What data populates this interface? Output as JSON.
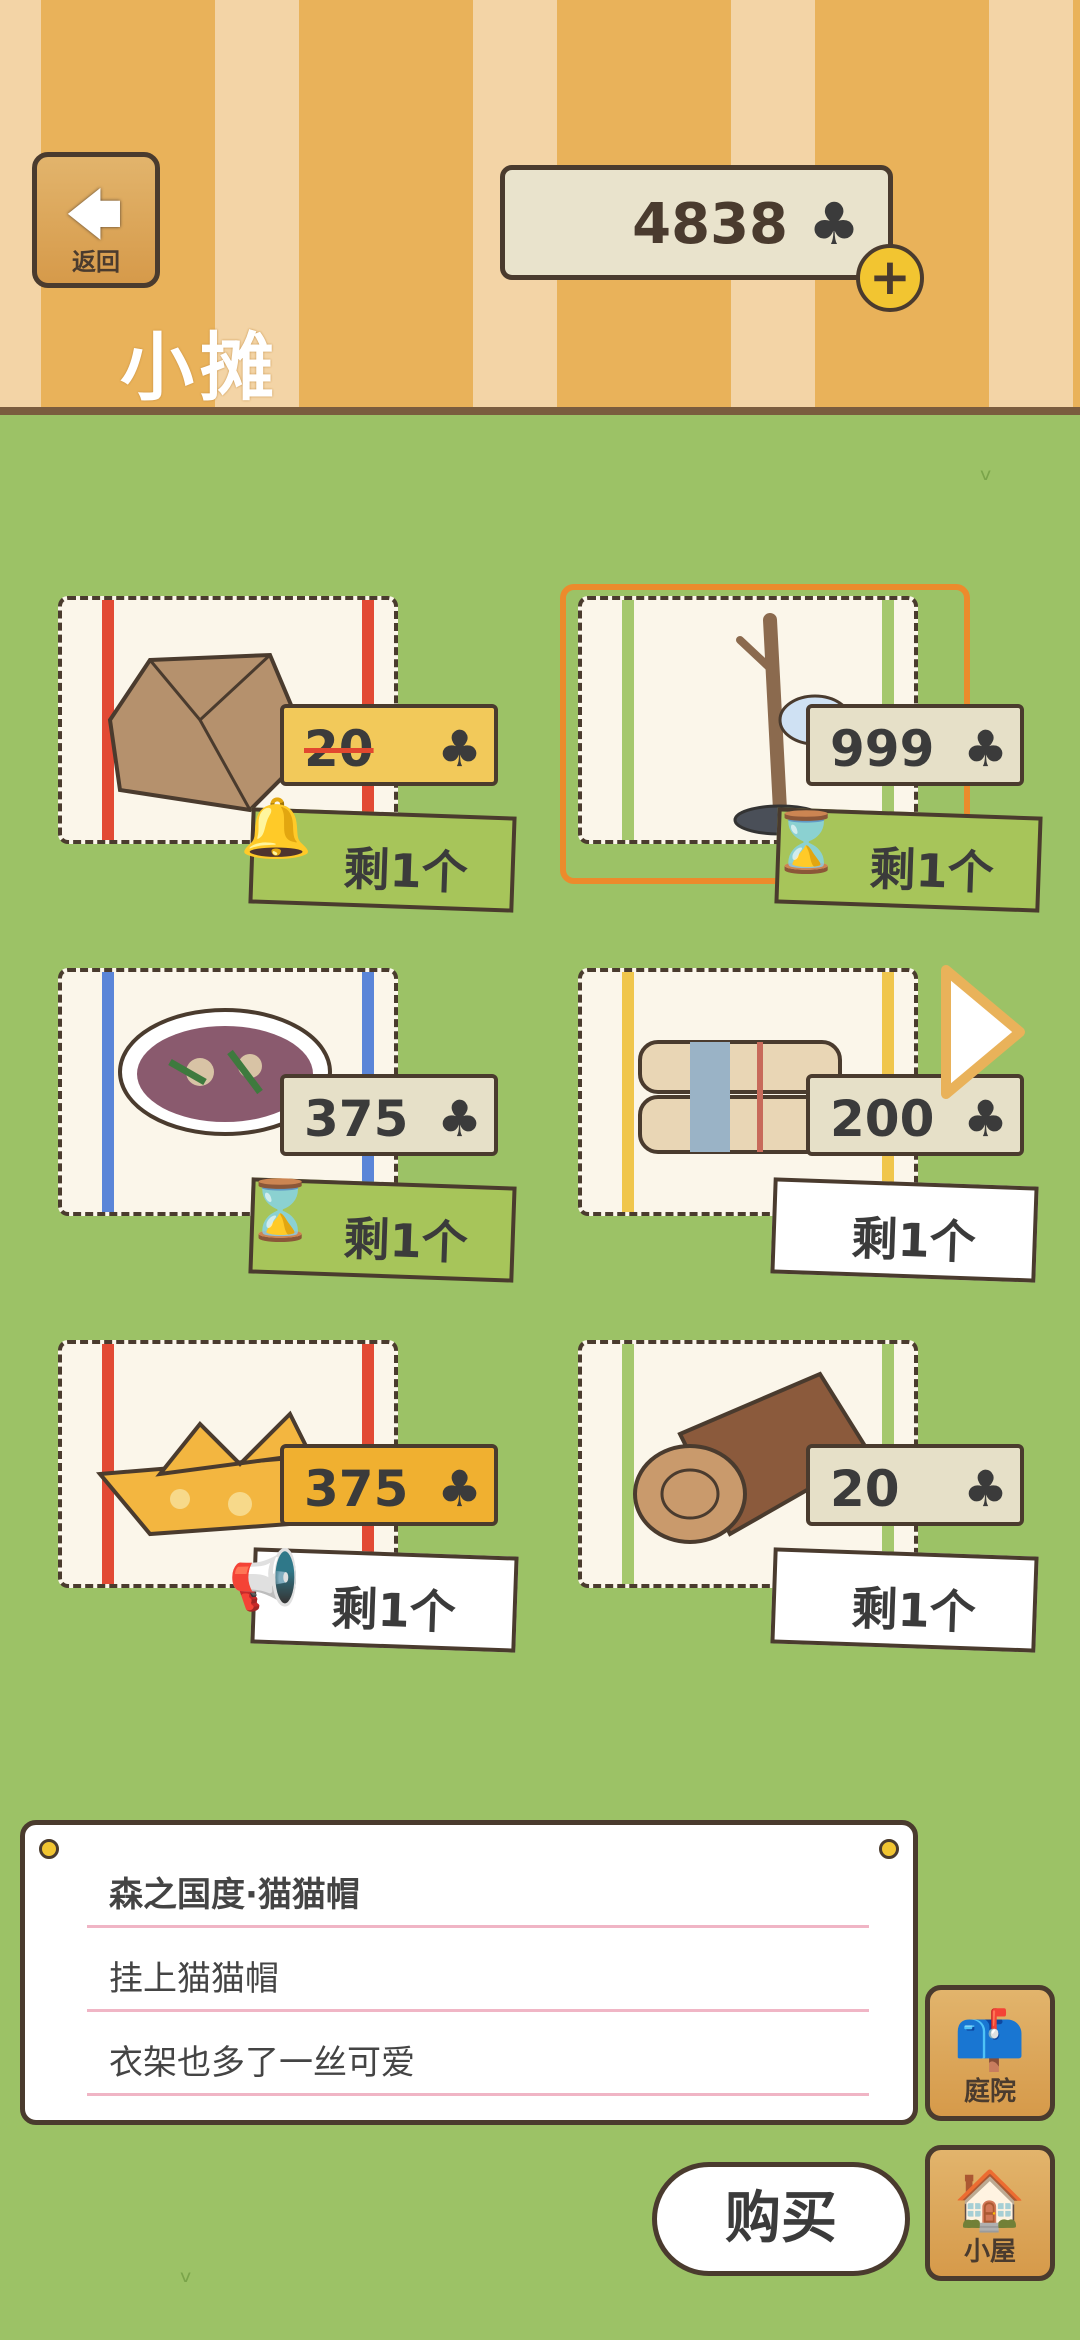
{
  "header": {
    "back_label": "返回",
    "title": "小摊",
    "coins": "4838"
  },
  "icons": {
    "clover": "♣",
    "plus": "+",
    "back": "🡄",
    "bell": "🔔",
    "hourglass": "⌛",
    "megaphone": "📢",
    "mailbox": "📫",
    "house": "🏠"
  },
  "items": [
    {
      "price": "20",
      "remaining": "剩1个",
      "style": "sale",
      "badge": "bell-icon",
      "colors": {
        "stripe": "#e24a34"
      }
    },
    {
      "price": "999",
      "remaining": "剩1个",
      "style": "timed",
      "badge": "hourglass-icon",
      "colors": {
        "stripe": "#a5c86d"
      }
    },
    {
      "price": "375",
      "remaining": "剩1个",
      "style": "timed",
      "badge": "hourglass-icon",
      "colors": {
        "stripe": "#5a85d8"
      }
    },
    {
      "price": "200",
      "remaining": "剩1个",
      "style": "plain",
      "badge": "",
      "colors": {
        "stripe": "#f0c64c"
      }
    },
    {
      "price": "375",
      "remaining": "剩1个",
      "style": "promo",
      "badge": "megaphone-icon",
      "colors": {
        "stripe": "#e24a34"
      }
    },
    {
      "price": "20",
      "remaining": "剩1个",
      "style": "plain",
      "badge": "",
      "colors": {
        "stripe": "#a5c86d"
      }
    }
  ],
  "description": {
    "name": "森之国度·猫猫帽",
    "line1": "挂上猫猫帽",
    "line2": "衣架也多了一丝可爱"
  },
  "buttons": {
    "yard": "庭院",
    "house": "小屋",
    "buy": "购买"
  }
}
